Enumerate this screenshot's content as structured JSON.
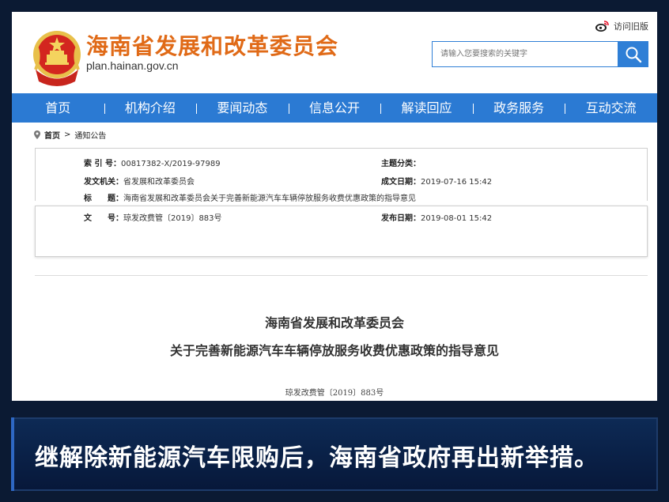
{
  "site": {
    "title": "海南省发展和改革委员会",
    "url": "plan.hainan.gov.cn",
    "old_site_link": "访问旧版"
  },
  "search": {
    "placeholder": "请输入您要搜索的关键字"
  },
  "nav": {
    "items": [
      "首页",
      "机构介绍",
      "要闻动态",
      "信息公开",
      "解读回应",
      "政务服务",
      "互动交流"
    ]
  },
  "breadcrumb": {
    "home": "首页",
    "separator": ">",
    "current": "通知公告"
  },
  "meta": {
    "index_label": "索 引 号：",
    "index_value": "00817382-X/2019-97989",
    "topic_label": "主题分类：",
    "topic_value": "",
    "issuer_label": "发文机关：",
    "issuer_value": "省发展和改革委员会",
    "created_label": "成文日期：",
    "created_value": "2019-07-16 15:42",
    "title_label": "标　　题：",
    "title_value": "海南省发展和改革委员会关于完善新能源汽车车辆停放服务收费优惠政策的指导意见",
    "docno_label": "文　　号：",
    "docno_value": "琼发改费管〔2019〕883号",
    "published_label": "发布日期：",
    "published_value": "2019-08-01 15:42"
  },
  "document": {
    "org": "海南省发展和改革委员会",
    "title": "关于完善新能源汽车车辆停放服务收费优惠政策的指导意见",
    "number": "琼发改费管〔2019〕883号"
  },
  "caption": {
    "text": "继解除新能源汽车限购后，海南省政府再出新举措。"
  },
  "colors": {
    "nav_bg": "#2b7ad3",
    "title_orange": "#e06a17",
    "background": "#0b1a33"
  }
}
